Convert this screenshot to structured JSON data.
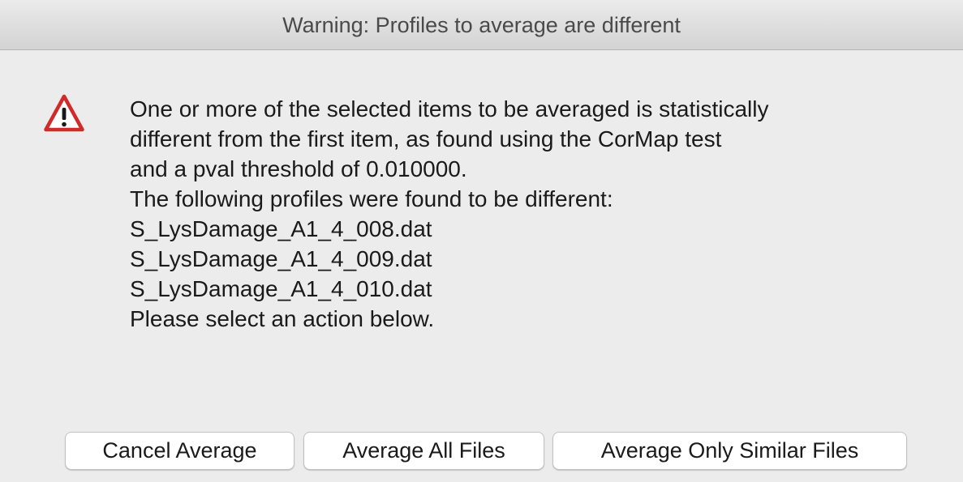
{
  "window": {
    "title": "Warning: Profiles to average are different"
  },
  "icon": {
    "name": "warning-icon",
    "color": "#d12a2a"
  },
  "message": {
    "lines": [
      "One or more of the selected items to be averaged is statistically",
      "different from the first item, as found using the CorMap test",
      "and a pval threshold of 0.010000.",
      "The following profiles were found to be different:",
      "S_LysDamage_A1_4_008.dat",
      "S_LysDamage_A1_4_009.dat",
      "S_LysDamage_A1_4_010.dat",
      "Please select an action below."
    ]
  },
  "buttons": {
    "cancel_label": "Cancel Average",
    "all_label": "Average All Files",
    "similar_label": "Average Only Similar Files"
  }
}
